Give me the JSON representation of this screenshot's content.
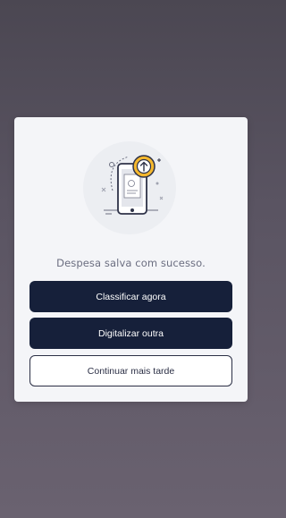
{
  "modal": {
    "message": "Despesa salva com sucesso.",
    "illustration": "phone-upload-icon",
    "buttons": {
      "classify_label": "Classificar agora",
      "scan_label": "Digitalizar outra",
      "later_label": "Continuar mais tarde"
    }
  },
  "colors": {
    "primary_button": "#16203a",
    "accent_upload": "#f5b82e",
    "modal_background": "#f4f5f8",
    "message_text": "#6b6e80"
  }
}
